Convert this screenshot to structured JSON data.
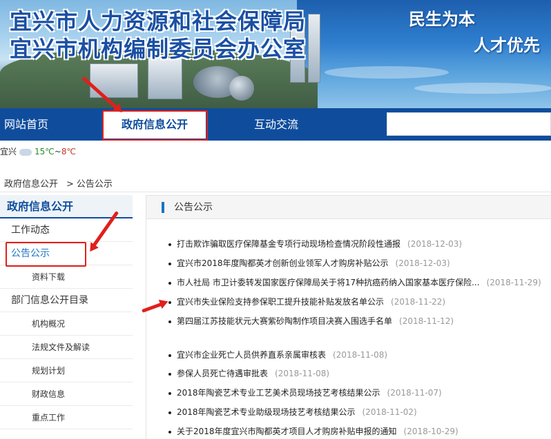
{
  "header": {
    "title_line1": "宜兴市人力资源和社会保障局",
    "title_line2": "宜兴市机构编制委员会办公室",
    "slogan1": "民生为本",
    "slogan2": "人才优先"
  },
  "nav": {
    "items": [
      {
        "label": "网站首页"
      },
      {
        "label": "政府信息公开"
      },
      {
        "label": "互动交流"
      }
    ],
    "search_placeholder": ""
  },
  "weather": {
    "city": "宜兴",
    "high": "15℃",
    "separator": "~",
    "low": "8℃"
  },
  "breadcrumb": {
    "root": "政府信息公开",
    "sep": ">",
    "current": "公告公示"
  },
  "sidebar": {
    "heading": "政府信息公开",
    "items": [
      {
        "label": "工作动态"
      },
      {
        "label": "公告公示"
      },
      {
        "label": "资料下载"
      },
      {
        "label": "部门信息公开目录"
      },
      {
        "label": "机构概况"
      },
      {
        "label": "法规文件及解读"
      },
      {
        "label": "规划计划"
      },
      {
        "label": "财政信息"
      },
      {
        "label": "重点工作"
      }
    ]
  },
  "main": {
    "section_title": "公告公示",
    "news": [
      {
        "title": "打击欺诈骗取医疗保障基金专项行动现场检查情况阶段性通报",
        "date": "(2018-12-03)"
      },
      {
        "title": "宜兴市2018年度陶都英才创新创业领军人才购房补贴公示",
        "date": "(2018-12-03)"
      },
      {
        "title": "市人社局 市卫计委转发国家医疗保障局关于将17种抗癌药纳入国家基本医疗保险...",
        "date": "(2018-11-29)"
      },
      {
        "title": "宜兴市失业保险支持参保职工提升技能补贴发放名单公示",
        "date": "(2018-11-22)"
      },
      {
        "title": "第四届江苏技能状元大赛紫砂陶制作项目决赛入围选手名单",
        "date": "(2018-11-12)"
      },
      {
        "title": "宜兴市企业死亡人员供养直系亲属审核表",
        "date": "(2018-11-08)"
      },
      {
        "title": "参保人员死亡待遇审批表",
        "date": "(2018-11-08)"
      },
      {
        "title": "2018年陶瓷艺术专业工艺美术员现场技艺考核结果公示",
        "date": "(2018-11-07)"
      },
      {
        "title": "2018年陶瓷艺术专业助级现场技艺考核结果公示",
        "date": "(2018-11-02)"
      },
      {
        "title": "关于2018年度宜兴市陶都英才项目人才购房补贴申报的通知",
        "date": "(2018-10-29)"
      }
    ]
  },
  "colors": {
    "nav_bg": "#0f4d9c",
    "accent": "#1a73c4",
    "annotation": "#e0201c"
  }
}
